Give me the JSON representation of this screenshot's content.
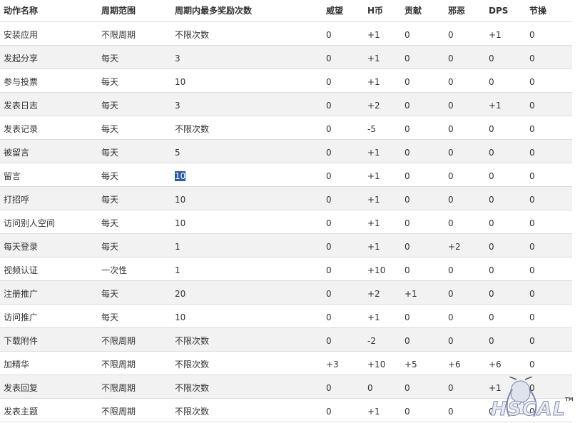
{
  "table": {
    "headers": [
      "动作名称",
      "周期范围",
      "周期内最多奖励次数",
      "威望",
      "H币",
      "贡献",
      "邪恶",
      "DPS",
      "节操"
    ],
    "rows": [
      [
        "安装应用",
        "不限周期",
        "不限次数",
        "0",
        "+1",
        "0",
        "0",
        "+1",
        "0"
      ],
      [
        "发起分享",
        "每天",
        "3",
        "0",
        "+1",
        "0",
        "0",
        "0",
        "0"
      ],
      [
        "参与投票",
        "每天",
        "10",
        "0",
        "+1",
        "0",
        "0",
        "0",
        "0"
      ],
      [
        "发表日志",
        "每天",
        "3",
        "0",
        "+2",
        "0",
        "0",
        "+1",
        "0"
      ],
      [
        "发表记录",
        "每天",
        "不限次数",
        "0",
        "-5",
        "0",
        "0",
        "0",
        "0"
      ],
      [
        "被留言",
        "每天",
        "5",
        "0",
        "+1",
        "0",
        "0",
        "0",
        "0"
      ],
      [
        "留言",
        "每天",
        "10",
        "0",
        "+1",
        "0",
        "0",
        "0",
        "0"
      ],
      [
        "打招呼",
        "每天",
        "10",
        "0",
        "+1",
        "0",
        "0",
        "0",
        "0"
      ],
      [
        "访问别人空间",
        "每天",
        "10",
        "0",
        "+1",
        "0",
        "0",
        "0",
        "0"
      ],
      [
        "每天登录",
        "每天",
        "1",
        "0",
        "+1",
        "0",
        "+2",
        "0",
        "0"
      ],
      [
        "视频认证",
        "一次性",
        "1",
        "0",
        "+10",
        "0",
        "0",
        "0",
        "0"
      ],
      [
        "注册推广",
        "每天",
        "20",
        "0",
        "+2",
        "+1",
        "0",
        "0",
        "0"
      ],
      [
        "访问推广",
        "每天",
        "10",
        "0",
        "+1",
        "0",
        "0",
        "0",
        "0"
      ],
      [
        "下载附件",
        "不限周期",
        "不限次数",
        "0",
        "-2",
        "0",
        "0",
        "0",
        "0"
      ],
      [
        "加精华",
        "不限周期",
        "不限次数",
        "+3",
        "+10",
        "+5",
        "+6",
        "+6",
        "0"
      ],
      [
        "发表回复",
        "不限周期",
        "不限次数",
        "0",
        "0",
        "0",
        "0",
        "+1",
        "0"
      ],
      [
        "发表主题",
        "不限周期",
        "不限次数",
        "0",
        "+1",
        "0",
        "0",
        "0",
        "0"
      ]
    ],
    "selected_cell": {
      "row": 6,
      "col": 2
    }
  },
  "watermark": {
    "logo_text": "HSCAL",
    "mark": "TM"
  }
}
